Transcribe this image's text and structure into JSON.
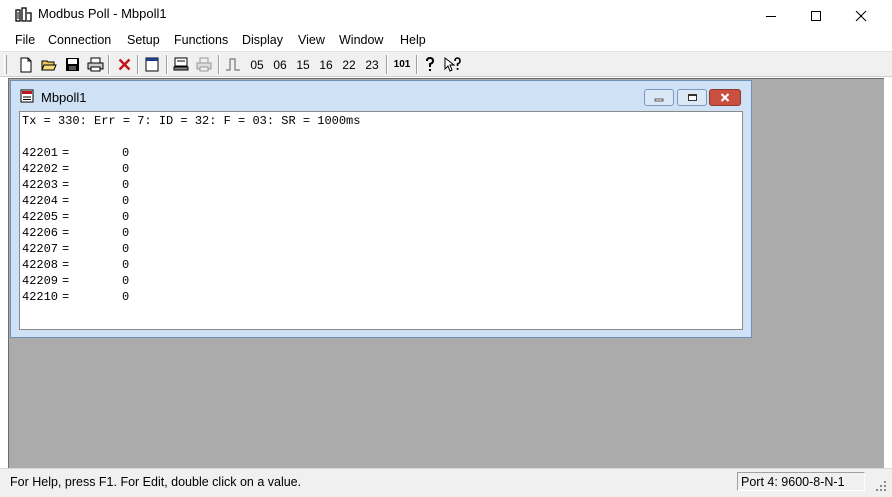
{
  "window": {
    "title": "Modbus Poll - Mbpoll1",
    "icon": "modbus-poll-app-icon",
    "controls": [
      "minimize-icon",
      "maximize-icon",
      "close-icon"
    ]
  },
  "menu": {
    "items": [
      {
        "label": "File"
      },
      {
        "label": "Connection"
      },
      {
        "label": "Setup"
      },
      {
        "label": "Functions"
      },
      {
        "label": "Display"
      },
      {
        "label": "View"
      },
      {
        "label": "Window"
      },
      {
        "label": "Help"
      }
    ]
  },
  "toolbar": {
    "function_codes": [
      "05",
      "06",
      "15",
      "16",
      "22",
      "23"
    ],
    "code_101": "101",
    "icons": [
      "new-icon",
      "open-icon",
      "save-icon",
      "print-icon",
      "disconnect-icon",
      "window-icon",
      "connect-icon",
      "read-write-icon",
      "pulse-icon",
      "about-icon",
      "context-help-icon"
    ]
  },
  "child_window": {
    "title": "Mbpoll1",
    "status_line": "Tx = 330: Err = 7: ID = 32: F = 03: SR = 1000ms",
    "registers": [
      {
        "address": "42201",
        "eq": "=",
        "value": "0"
      },
      {
        "address": "42202",
        "eq": "=",
        "value": "0"
      },
      {
        "address": "42203",
        "eq": "=",
        "value": "0"
      },
      {
        "address": "42204",
        "eq": "=",
        "value": "0"
      },
      {
        "address": "42205",
        "eq": "=",
        "value": "0"
      },
      {
        "address": "42206",
        "eq": "=",
        "value": "0"
      },
      {
        "address": "42207",
        "eq": "=",
        "value": "0"
      },
      {
        "address": "42208",
        "eq": "=",
        "value": "0"
      },
      {
        "address": "42209",
        "eq": "=",
        "value": "0"
      },
      {
        "address": "42210",
        "eq": "=",
        "value": "0"
      }
    ]
  },
  "statusbar": {
    "help_text": "For Help, press F1.  For Edit, double click on a value.",
    "port": "Port 4: 9600-8-N-1"
  },
  "colors": {
    "mdi_background": "#ababab",
    "child_frame": "#cfe1f5",
    "close_button": "#c9503f"
  }
}
